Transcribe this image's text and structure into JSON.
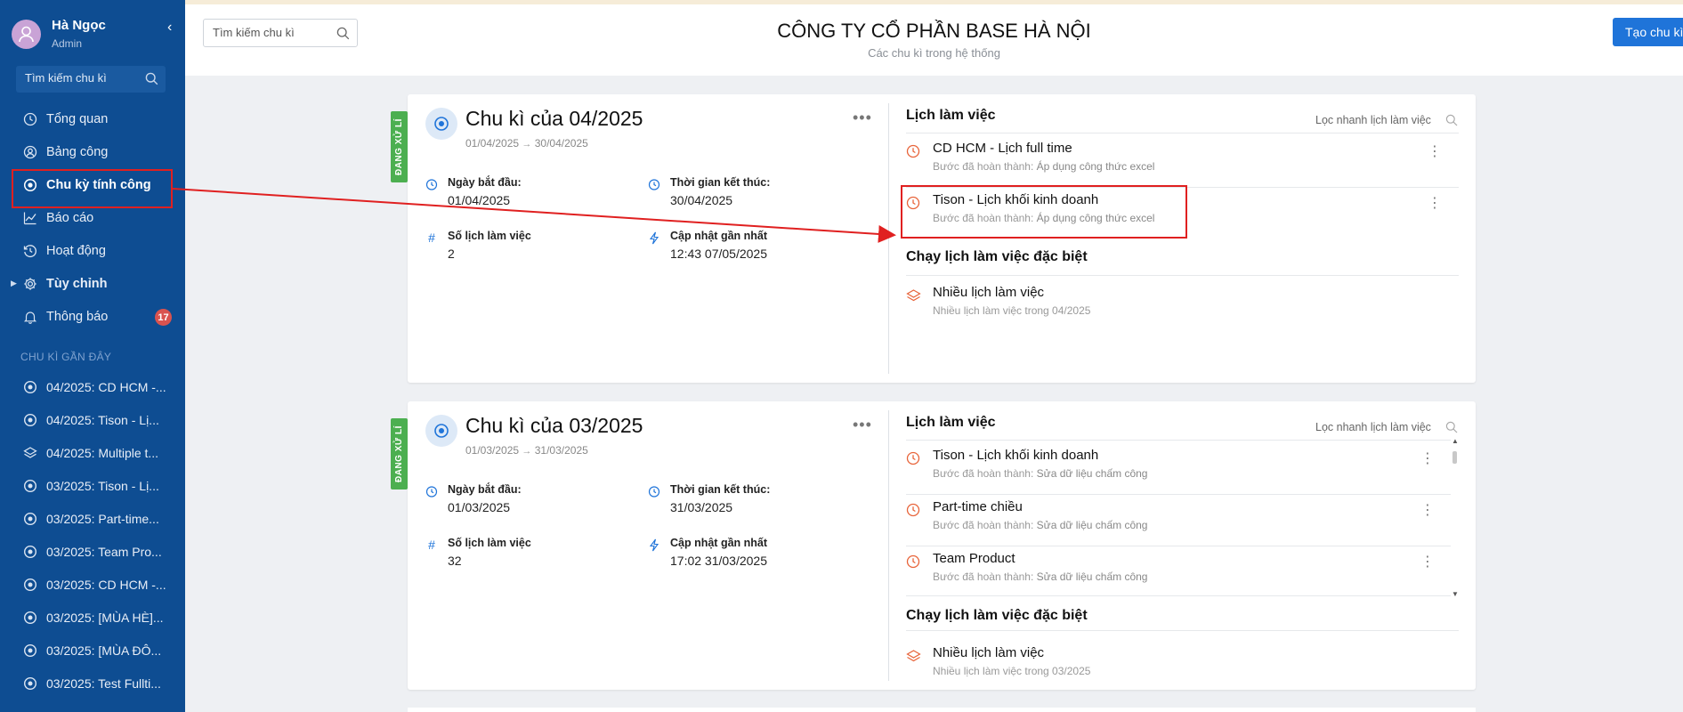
{
  "user": {
    "name": "Hà Ngọc",
    "role": "Admin"
  },
  "sidebar": {
    "search_placeholder": "Tìm kiếm chu kì",
    "nav": [
      {
        "label": "Tổng quan",
        "icon": "clock-icon"
      },
      {
        "label": "Bảng công",
        "icon": "user-circle-icon"
      },
      {
        "label": "Chu kỳ tính công",
        "icon": "target-icon",
        "active": true
      },
      {
        "label": "Báo cáo",
        "icon": "chart-line-icon"
      },
      {
        "label": "Hoạt động",
        "icon": "history-icon"
      },
      {
        "label": "Tùy chỉnh",
        "icon": "gear-icon"
      },
      {
        "label": "Thông báo",
        "icon": "bell-icon",
        "badge": "17"
      }
    ],
    "recent_label": "CHU KÌ GẦN ĐÂY",
    "recent": [
      {
        "label": "04/2025: CD HCM -...",
        "icon": "target-icon"
      },
      {
        "label": "04/2025: Tison - Lị...",
        "icon": "target-icon"
      },
      {
        "label": "04/2025: Multiple t...",
        "icon": "layers-icon"
      },
      {
        "label": "03/2025: Tison - Lị...",
        "icon": "target-icon"
      },
      {
        "label": "03/2025: Part-time...",
        "icon": "target-icon"
      },
      {
        "label": "03/2025: Team Pro...",
        "icon": "target-icon"
      },
      {
        "label": "03/2025: CD HCM -...",
        "icon": "target-icon"
      },
      {
        "label": "03/2025: [MÙA HÈ]...",
        "icon": "target-icon"
      },
      {
        "label": "03/2025: [MÙA ĐÔ...",
        "icon": "target-icon"
      },
      {
        "label": "03/2025: Test Fullti...",
        "icon": "target-icon"
      }
    ]
  },
  "header": {
    "search_placeholder": "Tìm kiếm chu kì",
    "company": "CÔNG TY CỔ PHẦN BASE HÀ NỘI",
    "subtitle": "Các chu kì trong hệ thống",
    "create_button": "Tạo chu kì"
  },
  "cycles": [
    {
      "status": "ĐANG XỬ LÍ",
      "title": "Chu kì của 04/2025",
      "start": "01/04/2025",
      "end": "30/04/2025",
      "fields": {
        "start_label": "Ngày bắt đầu:",
        "start_value": "01/04/2025",
        "end_label": "Thời gian kết thúc:",
        "end_value": "30/04/2025",
        "count_label": "Số lịch làm việc",
        "count_value": "2",
        "updated_label": "Cập nhật gần nhất",
        "updated_value": "12:43 07/05/2025"
      },
      "schedules_title": "Lịch làm việc",
      "filter_placeholder": "Lọc nhanh lịch làm việc",
      "step_prefix": "Bước đã hoàn thành:",
      "schedules": [
        {
          "name": "CD HCM - Lịch full time",
          "step": "Áp dụng công thức excel"
        },
        {
          "name": "Tison - Lịch khối kinh doanh",
          "step": "Áp dụng công thức excel"
        }
      ],
      "special_title": "Chạy lịch làm việc đặc biệt",
      "special": {
        "name": "Nhiều lịch làm việc",
        "desc": "Nhiều lịch làm việc trong 04/2025"
      }
    },
    {
      "status": "ĐANG XỬ LÍ",
      "title": "Chu kì của 03/2025",
      "start": "01/03/2025",
      "end": "31/03/2025",
      "fields": {
        "start_label": "Ngày bắt đầu:",
        "start_value": "01/03/2025",
        "end_label": "Thời gian kết thúc:",
        "end_value": "31/03/2025",
        "count_label": "Số lịch làm việc",
        "count_value": "32",
        "updated_label": "Cập nhật gần nhất",
        "updated_value": "17:02 31/03/2025"
      },
      "schedules_title": "Lịch làm việc",
      "filter_placeholder": "Lọc nhanh lịch làm việc",
      "step_prefix": "Bước đã hoàn thành:",
      "schedules": [
        {
          "name": "Tison - Lịch khối kinh doanh",
          "step": "Sửa dữ liệu chấm công"
        },
        {
          "name": "Part-time chiều",
          "step": "Sửa dữ liệu chấm công"
        },
        {
          "name": "Team Product",
          "step": "Sửa dữ liệu chấm công"
        }
      ],
      "special_title": "Chạy lịch làm việc đặc biệt",
      "special": {
        "name": "Nhiều lịch làm việc",
        "desc": "Nhiều lịch làm việc trong 03/2025"
      }
    }
  ],
  "colors": {
    "sidebar": "#0e4d92",
    "accent": "#1f74d9",
    "status_green": "#4caf50",
    "schedule_icon": "#e8643a",
    "annotation_red": "#e02020"
  }
}
